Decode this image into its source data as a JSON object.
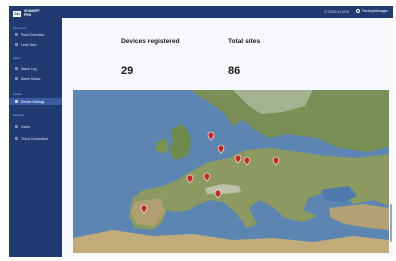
{
  "brand": {
    "badge": "SH",
    "line1": "SCHAEFF",
    "line2": "PRO"
  },
  "sidebar": {
    "sections": [
      {
        "label": "Overview",
        "items": [
          {
            "label": "Plant Overview",
            "active": false
          },
          {
            "label": "Limit View",
            "active": false
          }
        ]
      },
      {
        "label": "Alerts",
        "items": [
          {
            "label": "Alarm Log",
            "active": false
          },
          {
            "label": "Alarm Status",
            "active": false
          }
        ]
      },
      {
        "label": "Assets",
        "items": [
          {
            "label": "Device Settings",
            "active": true
          }
        ]
      },
      {
        "label": "Settings",
        "items": [
          {
            "label": "Users",
            "active": false
          },
          {
            "label": "Cloud Connection",
            "active": false
          }
        ]
      }
    ]
  },
  "topbar": {
    "user_id": "0773000-12.0478",
    "account": "FactoryManager"
  },
  "stats": [
    {
      "label": "Devices registered",
      "value": "29"
    },
    {
      "label": "Total sites",
      "value": "86"
    }
  ],
  "map": {
    "marker_count": 9,
    "marker_color": "#c62828",
    "sea_color": "#5d85b2"
  },
  "colors": {
    "sidebar": "#223a72",
    "active_item": "#3a5aa6",
    "content_bg": "#f7f8fb"
  }
}
